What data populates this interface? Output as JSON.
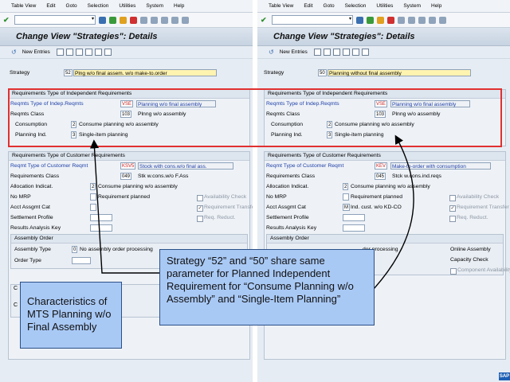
{
  "menu": [
    "Table View",
    "Edit",
    "Goto",
    "Selection",
    "Utilities",
    "System",
    "Help"
  ],
  "title": "Change View \"Strategies\": Details",
  "toolbar_new_entries": "New Entries",
  "left": {
    "strategy_label": "Strategy",
    "strategy_code": "52",
    "strategy_desc": "Plng w/o final assem. w/o make-to.order",
    "indep_group_title": "Requirements Type of Independent Requirements",
    "reqmts_type_label": "Reqmts Type of Indep.Reqmts",
    "reqmts_type_code": "VSE",
    "reqmts_type_desc": "Planning w/o final assembly",
    "reqmts_class_label": "Reqmts Class",
    "reqmts_class_code": "103",
    "reqmts_class_desc": "Plnng w/o assembly",
    "consumption_label": "Consumption",
    "consumption_code": "2",
    "consumption_desc": "Consume planning w/o assembly",
    "planning_ind_label": "Planning Ind.",
    "planning_ind_code": "3",
    "planning_ind_desc": "Single-item planning",
    "cust_group_title": "Requirements Type of Customer Requirements",
    "cust_reqmt_label": "Reqmt Type of Customer Reqmt",
    "cust_reqmt_code": "KSV5",
    "cust_reqmt_desc": "Stock with cons.w/o final ass.",
    "cust_class_label": "Requirements Class",
    "cust_class_code": "049",
    "cust_class_desc": "Stk w.cons.w/o F.Ass",
    "alloc_label": "Allocation Indicat.",
    "alloc_code": "2",
    "alloc_desc": "Consume planning w/o assembly",
    "nomrp_label": "No MRP",
    "nomrp_desc": "Requirement planned",
    "avail_label": "Availability Check",
    "acct_label": "Acct Assgmt Cat",
    "req_transfer_label": "Requirement Transfer",
    "settle_label": "Settlement Profile",
    "req_reduct_label": "Req. Reduct.",
    "results_label": "Results Analysis Key",
    "assembly_title": "Assembly Order",
    "assembly_type_label": "Assembly Type",
    "assembly_type_code": "0",
    "assembly_type_desc": "No assembly order processing",
    "order_type_label": "Order Type",
    "cut_c1": "C",
    "cut_c2": "C"
  },
  "right": {
    "strategy_label": "Strategy",
    "strategy_code": "50",
    "strategy_desc": "Planning without final assembly",
    "indep_group_title": "Requirements Type of Independent Requirements",
    "reqmts_type_label": "Reqmts Type of Indep.Reqmts",
    "reqmts_type_code": "VSE",
    "reqmts_type_desc": "Planning w/o final assembly",
    "reqmts_class_label": "Reqmts Class",
    "reqmts_class_code": "103",
    "reqmts_class_desc": "Plnng w/o assembly",
    "consumption_label": "Consumption",
    "consumption_code": "2",
    "consumption_desc": "Consume planning w/o assembly",
    "planning_ind_label": "Planning Ind.",
    "planning_ind_code": "3",
    "planning_ind_desc": "Single-item planning",
    "cust_group_title": "Requirements Type of Customer Requirements",
    "cust_reqmt_label": "Reqmt Type of Customer Reqmt",
    "cust_reqmt_code": "KEV",
    "cust_reqmt_desc": "Make-to-order with consumption",
    "cust_class_label": "Requirements Class",
    "cust_class_code": "045",
    "cust_class_desc": "Stck w.cons.ind.reqs",
    "alloc_label": "Allocation Indicat.",
    "alloc_code": "2",
    "alloc_desc": "Consume planning w/o assembly",
    "nomrp_label": "No MRP",
    "nomrp_desc": "Requirement planned",
    "avail_label": "Availability Check",
    "acct_label": "Acct Assgmt Cat",
    "acct_code": "M",
    "acct_desc": "Ind. cust. w/o KD-CO",
    "req_transfer_label": "Requirement Transfer",
    "settle_label": "Settlement Profile",
    "req_reduct_label": "Req. Reduct.",
    "results_label": "Results Analysis Key",
    "assembly_title": "Assembly Order",
    "assembly_tail": "der processing",
    "online_assembly_label": "Online Assembly",
    "capacity_check_label": "Capacity Check",
    "component_avail_label": "Component Availability"
  },
  "callouts": {
    "strategy": "Strategy “52” and “50” share same parameter for Planned Independent Requirement for “Consume Planning w/o Assembly” and “Single-Item Planning”",
    "mts": "Characteristics of MTS Planning w/o Final Assembly"
  },
  "sap_logo": "SAP",
  "colors": {
    "highlight_border": "#e03030",
    "callout_fill": "#a9c9f5",
    "label_blue": "#1f3fa6",
    "code_red": "#c62020"
  }
}
